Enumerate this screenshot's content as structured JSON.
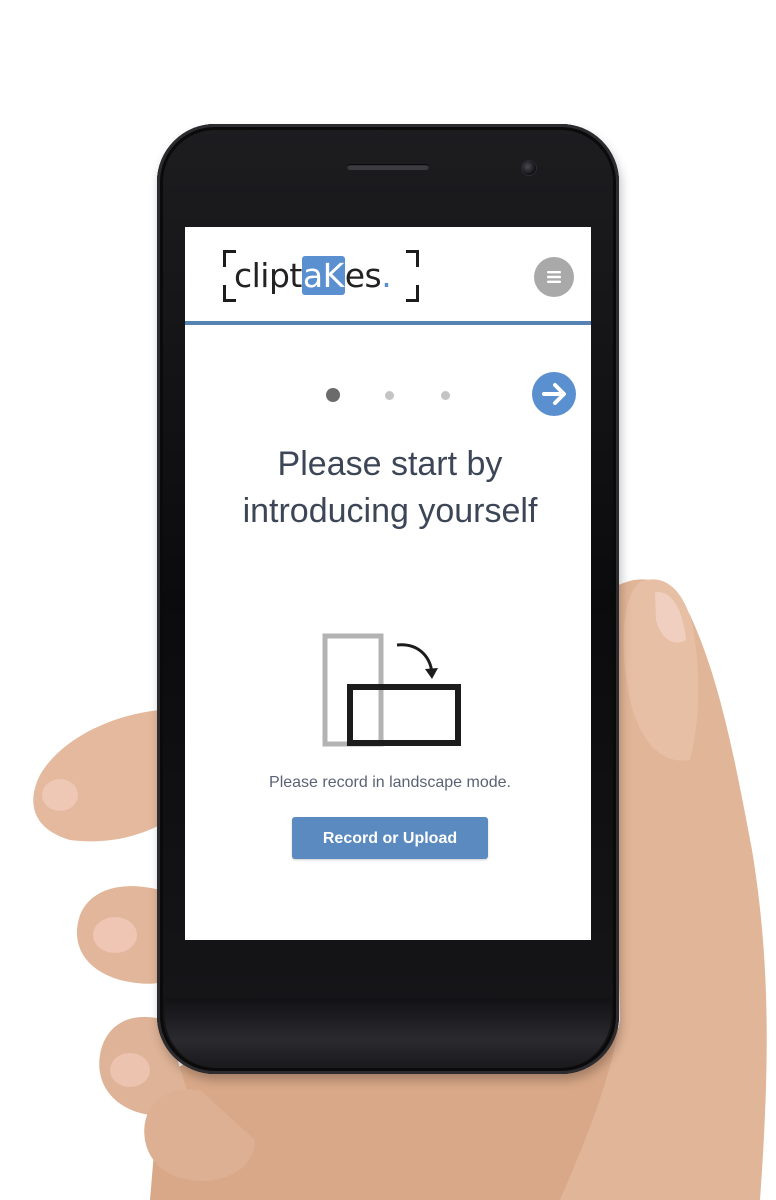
{
  "header": {
    "logo": {
      "text_before": "clipt",
      "text_highlight": "aK",
      "text_after": "es",
      "text_dot": "."
    },
    "menu_icon": "hamburger-icon"
  },
  "carousel": {
    "total_steps": 3,
    "current_step": 1,
    "next_icon": "arrow-right-icon"
  },
  "main": {
    "headline": "Please start by introducing yourself",
    "illustration_icon": "rotate-to-landscape-icon",
    "note": "Please record in landscape mode.",
    "cta_label": "Record or Upload"
  },
  "colors": {
    "accent": "#5683b4",
    "button": "#5a8ac0",
    "logo_highlight": "#5a8fd0",
    "menu_button": "#a9a9a9",
    "text": "#3d4657"
  }
}
